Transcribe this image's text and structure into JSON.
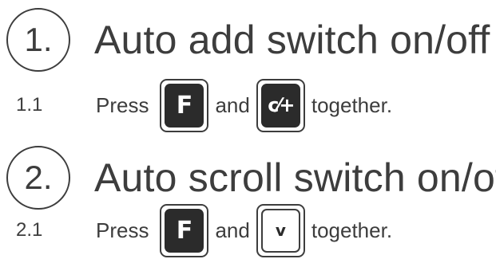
{
  "sections": [
    {
      "number": "1.",
      "title": "Auto add switch on/off",
      "step": {
        "number": "1.1",
        "press": "Press",
        "and": "and",
        "together": "together.",
        "keys": [
          {
            "label": "F",
            "style": "dark"
          },
          {
            "label": "c⁄+",
            "style": "dark"
          }
        ]
      }
    },
    {
      "number": "2.",
      "title": "Auto scroll switch on/off",
      "step": {
        "number": "2.1",
        "press": "Press",
        "and": "and",
        "together": "together.",
        "keys": [
          {
            "label": "F",
            "style": "dark"
          },
          {
            "label": "v",
            "style": "light"
          }
        ]
      }
    }
  ],
  "colors": {
    "text": "#3d3d3d",
    "key_dark": "#2b2b2b",
    "key_light": "#ffffff"
  }
}
